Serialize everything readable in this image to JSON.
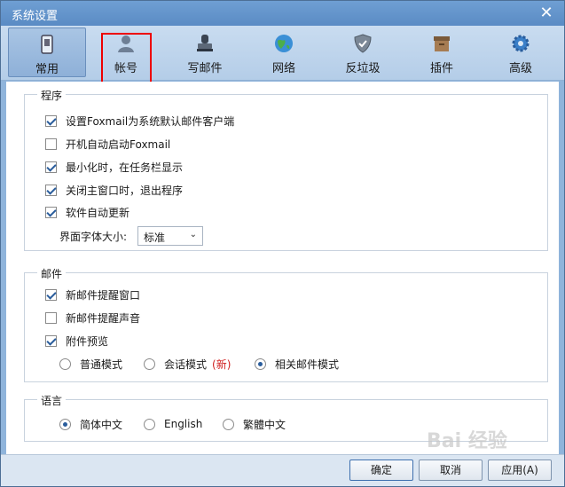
{
  "window": {
    "title": "系统设置"
  },
  "toolbar": {
    "tabs": [
      {
        "label": "常用",
        "icon": "phone-icon"
      },
      {
        "label": "帐号",
        "icon": "user-icon"
      },
      {
        "label": "写邮件",
        "icon": "stamp-icon"
      },
      {
        "label": "网络",
        "icon": "globe-icon"
      },
      {
        "label": "反垃圾",
        "icon": "shield-icon"
      },
      {
        "label": "插件",
        "icon": "box-icon"
      },
      {
        "label": "高级",
        "icon": "gear-icon"
      }
    ],
    "active_tab": "常用"
  },
  "program": {
    "title": "程序",
    "options": [
      {
        "label": "设置Foxmail为系统默认邮件客户端",
        "checked": true
      },
      {
        "label": "开机自动启动Foxmail",
        "checked": false
      },
      {
        "label": "最小化时，在任务栏显示",
        "checked": true
      },
      {
        "label": "关闭主窗口时，退出程序",
        "checked": true
      },
      {
        "label": "软件自动更新",
        "checked": true
      }
    ],
    "font_size_label": "界面字体大小:",
    "font_size_value": "标准"
  },
  "mail": {
    "title": "邮件",
    "options": [
      {
        "label": "新邮件提醒窗口",
        "checked": true
      },
      {
        "label": "新邮件提醒声音",
        "checked": false
      },
      {
        "label": "附件预览",
        "checked": true
      }
    ],
    "modes": [
      {
        "label": "普通模式",
        "selected": false
      },
      {
        "label": "会话模式",
        "selected": false,
        "badge": "(新)"
      },
      {
        "label": "相关邮件模式",
        "selected": true
      }
    ]
  },
  "language": {
    "title": "语言",
    "options": [
      {
        "label": "简体中文",
        "selected": true
      },
      {
        "label": "English",
        "selected": false
      },
      {
        "label": "繁體中文",
        "selected": false
      }
    ]
  },
  "footer": {
    "ok_label": "确定",
    "cancel_label": "取消",
    "apply_label": "应用(A)"
  },
  "watermark": "Bai 经验",
  "colors": {
    "accent": "#2a5d9c",
    "highlight_box": "#ee0000",
    "new_badge": "#d02020"
  }
}
